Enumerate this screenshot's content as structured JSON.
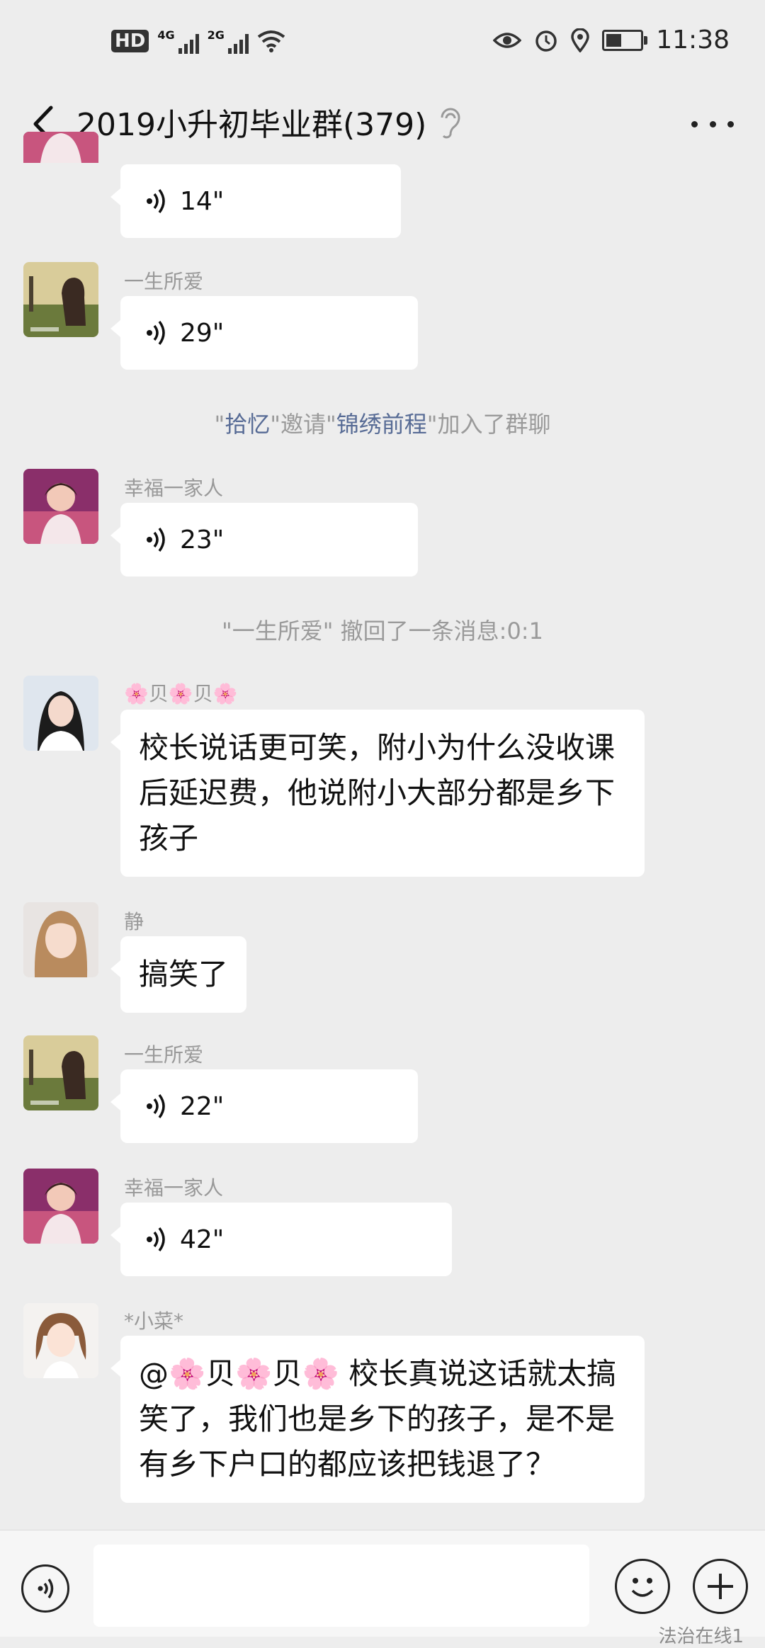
{
  "status": {
    "hd": "HD",
    "sim1": "4G",
    "sim2": "2G",
    "time": "11:38",
    "battery_level": 0.45
  },
  "header": {
    "title": "2019小升初毕业群(379)"
  },
  "messages": [
    {
      "sender": "",
      "voice": "14\""
    },
    {
      "sender": "一生所爱",
      "voice": "29\""
    },
    {
      "sender": "幸福一家人",
      "voice": "23\""
    },
    {
      "sender": "🌸贝🌸贝🌸",
      "text": "校长说话更可笑，附小为什么没收课后延迟费，他说附小大部分都是乡下孩子"
    },
    {
      "sender": "静",
      "text": "搞笑了"
    },
    {
      "sender": "一生所爱",
      "voice": "22\""
    },
    {
      "sender": "幸福一家人",
      "voice": "42\""
    },
    {
      "sender": "*小菜*",
      "text": "@🌸贝🌸贝🌸 校长真说这话就太搞笑了，我们也是乡下的孩子，是不是有乡下户口的都应该把钱退了？"
    }
  ],
  "system": {
    "invite": {
      "q1": "\"",
      "inviter": "拾忆",
      "mid": "\"邀请\"",
      "invitee": "锦绣前程",
      "end": "\"加入了群聊"
    },
    "recall": "\"一生所爱\" 撤回了一条消息:0:1"
  },
  "watermark": "法治在线1",
  "colors": {
    "background": "#ededed",
    "bubble": "#ffffff",
    "link": "#576b95",
    "meta": "#999999"
  }
}
